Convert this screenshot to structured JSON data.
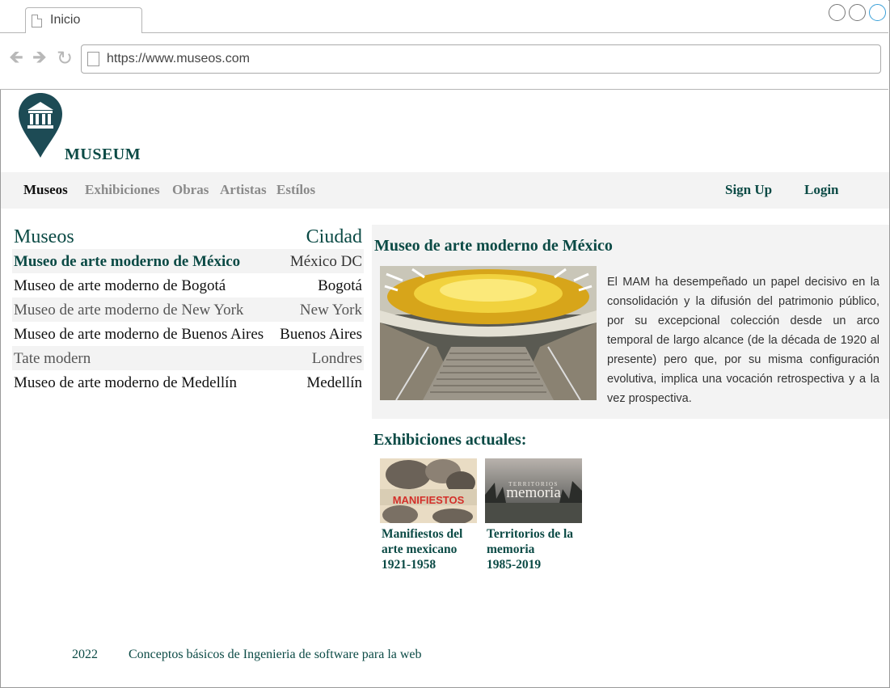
{
  "browser": {
    "tab_label": "Inicio",
    "url": "https://www.museos.com"
  },
  "header": {
    "brand": "MUSEUM",
    "logo_icon": "museum-pin-icon"
  },
  "nav": {
    "items": [
      "Museos",
      "Exhibiciones",
      "Obras",
      "Artistas",
      "Estílos"
    ],
    "active": "Museos",
    "sign_up": "Sign Up",
    "login": "Login"
  },
  "museum_table": {
    "headers": [
      "Museos",
      "Ciudad"
    ],
    "rows": [
      {
        "name": "Museo de arte moderno de México",
        "city": "México DC"
      },
      {
        "name": "Museo de arte moderno de Bogotá",
        "city": "Bogotá"
      },
      {
        "name": "Museo de arte moderno de New York",
        "city": "New York"
      },
      {
        "name": "Museo de arte moderno de Buenos Aires",
        "city": "Buenos Aires"
      },
      {
        "name": "Tate modern",
        "city": "Londres"
      },
      {
        "name": "Museo de arte moderno de Medellín",
        "city": "Medellín"
      }
    ]
  },
  "detail": {
    "title": "Museo de arte moderno de México",
    "description": "El MAM ha desempeñado un papel decisivo en la consolidación y la difusión del patrimonio público, por su excepcional colección desde un arco temporal de largo alcance (de la década de 1920 al presente) pero que, por su misma configuración evolutiva, implica una vocación retrospectiva y a la vez prospectiva."
  },
  "exhibitions": {
    "title": "Exhibiciones actuales:",
    "items": [
      {
        "line1": "Manifiestos del",
        "line2": "arte mexicano",
        "line3": "1921-1958",
        "poster_text": "MANIFIESTOS"
      },
      {
        "line1": "Territorios de la",
        "line2": "memoria",
        "line3": "1985-2019",
        "poster_text_small": "TERRITORIOS",
        "poster_text": "memoria"
      }
    ]
  },
  "footer": {
    "year": "2022",
    "text": "Conceptos básicos de Ingenieria de software para la web"
  },
  "colors": {
    "brand": "#0b4a45",
    "nav_bg": "#f3f3f3"
  }
}
